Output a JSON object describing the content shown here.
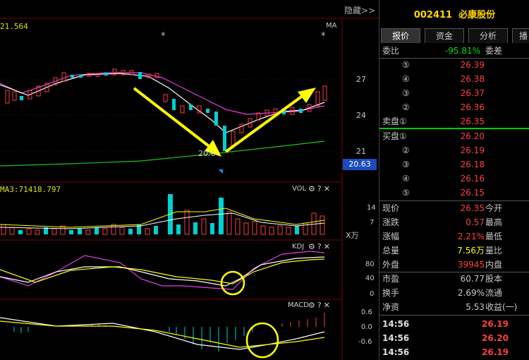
{
  "chart": {
    "hide_btn": "隐藏>>",
    "ma_value": "21.564",
    "ma_label": "MA",
    "price_ticks": [
      "27",
      "24",
      "21"
    ],
    "current_price": "20.63",
    "low_annot": "20.6",
    "vol_ma": "MA3:71418.797",
    "vol_label": "VOL",
    "vol_ticks": [
      "14",
      "7"
    ],
    "vol_unit": "X万",
    "kdj_label": "KDJ",
    "kdj_ticks": [
      "80",
      "40",
      "0"
    ],
    "macd_label": "MACD",
    "macd_ticks": [
      "0.6",
      "0.0",
      "-0.6"
    ],
    "icons": [
      "gear-icon",
      "question-icon",
      "close-icon"
    ]
  },
  "panel": {
    "code": "002411",
    "name": "必康股份",
    "tabs": [
      "报价",
      "资金",
      "分析",
      "播"
    ],
    "weibi_label": "委比",
    "weibi_value": "-95.81%",
    "weicha_label": "委差",
    "sell": [
      {
        "idx": "⑤",
        "price": "26.39"
      },
      {
        "idx": "④",
        "price": "26.38"
      },
      {
        "idx": "③",
        "price": "26.37"
      },
      {
        "idx": "②",
        "price": "26.36"
      },
      {
        "idx": "卖盘①",
        "price": "26.35"
      }
    ],
    "buy": [
      {
        "idx": "买盘①",
        "price": "26.20"
      },
      {
        "idx": "②",
        "price": "26.19"
      },
      {
        "idx": "③",
        "price": "26.18"
      },
      {
        "idx": "④",
        "price": "26.16"
      },
      {
        "idx": "⑤",
        "price": "26.15"
      }
    ],
    "stats": [
      {
        "label": "现价",
        "value": "26.35",
        "label2": "今开",
        "color": "#ff4040"
      },
      {
        "label": "涨跌",
        "value": "0.57",
        "label2": "最高",
        "color": "#ff4040"
      },
      {
        "label": "涨幅",
        "value": "2.21%",
        "label2": "最低",
        "color": "#ff4040"
      },
      {
        "label": "总量",
        "value": "7.56万",
        "label2": "量比",
        "color": "#ffff00"
      },
      {
        "label": "外盘",
        "value": "39945",
        "label2": "内盘",
        "color": "#ff4040"
      }
    ],
    "stats2": [
      {
        "label": "市盈",
        "value": "60.77",
        "label2": "股本",
        "color": "#c8c8c8"
      },
      {
        "label": "换手",
        "value": "2.69%",
        "label2": "流通",
        "color": "#c8c8c8"
      },
      {
        "label": "净资",
        "value": "5.53",
        "label2": "收益(一)",
        "color": "#c8c8c8"
      }
    ],
    "trades": [
      {
        "time": "14:56",
        "price": "26.19"
      },
      {
        "time": "14:56",
        "price": "26.20"
      },
      {
        "time": "14:56",
        "price": "26.19"
      }
    ]
  }
}
